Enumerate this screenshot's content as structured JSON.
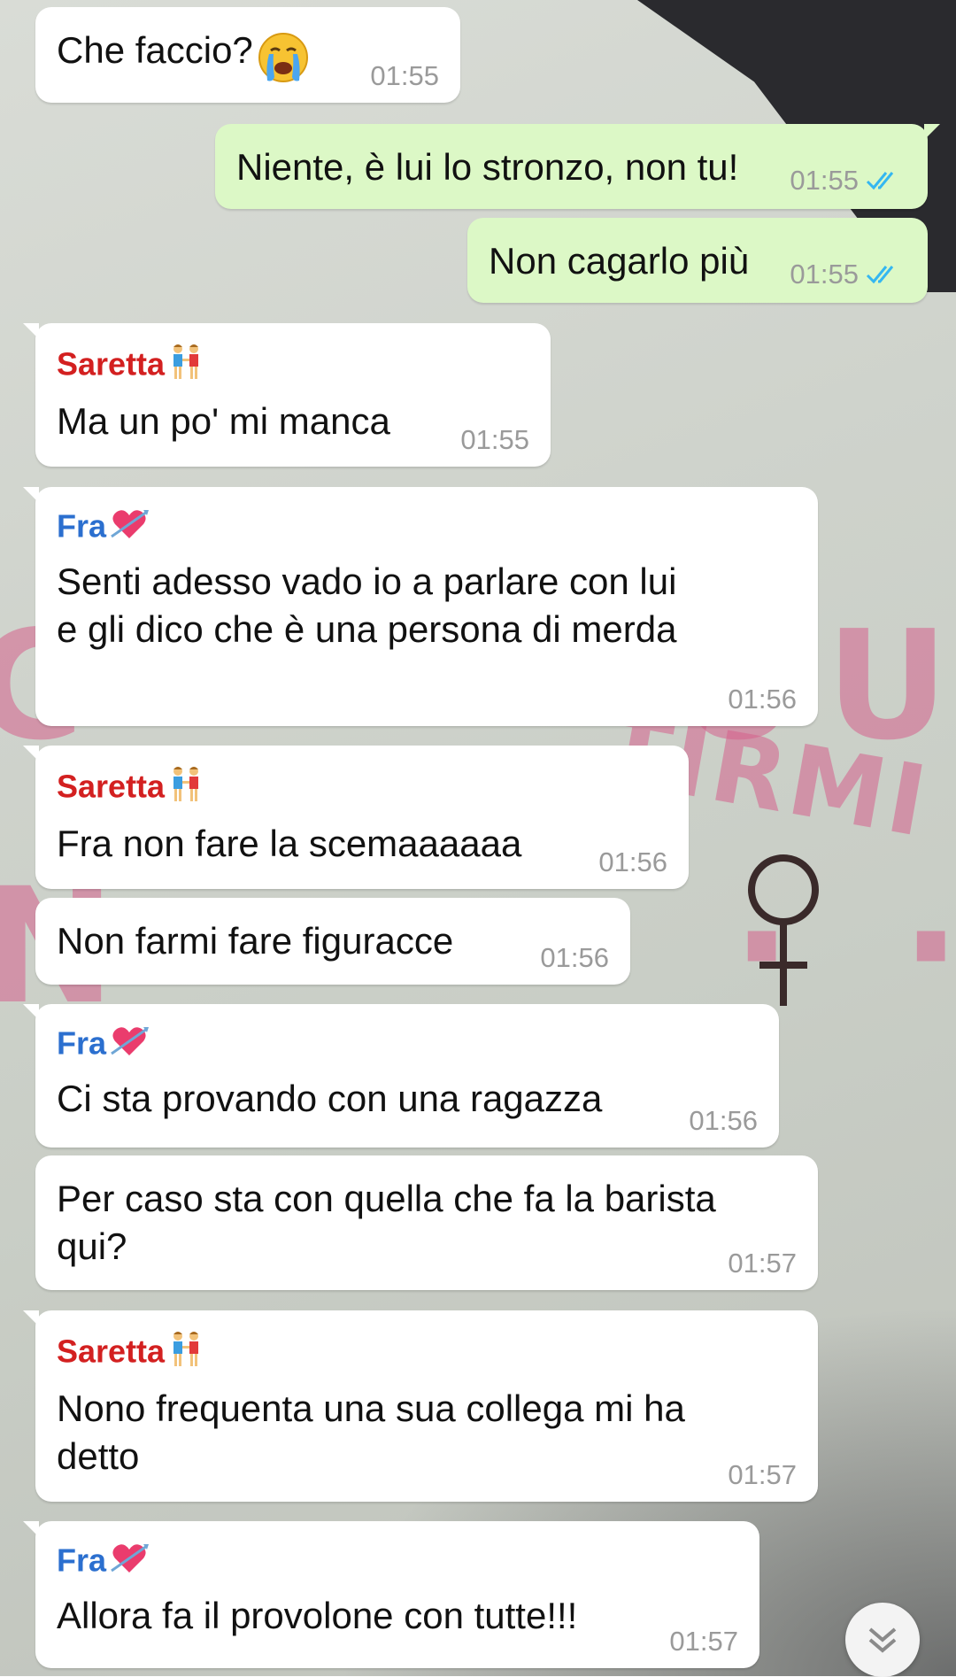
{
  "messages": [
    {
      "sender": "",
      "text": "Che faccio?",
      "emoji": "crying-face",
      "time": "01:55"
    },
    {
      "sender": "",
      "text": "Niente, è lui lo stronzo, non tu!",
      "time": "01:55",
      "status": "read"
    },
    {
      "sender": "",
      "text": "Non cagarlo più",
      "time": "01:55",
      "status": "read"
    },
    {
      "sender": "Saretta",
      "sender_emoji": "two-women-holding-hands",
      "text": "Ma un po' mi manca",
      "time": "01:55"
    },
    {
      "sender": "Fra",
      "sender_emoji": "heart-with-arrow",
      "text": "Senti adesso vado io a parlare con lui\ne gli dico che è una persona di merda",
      "time": "01:56"
    },
    {
      "sender": "Saretta",
      "sender_emoji": "two-women-holding-hands",
      "text": "Fra non fare la scemaaaaaa",
      "time": "01:56"
    },
    {
      "sender": "",
      "text": "Non farmi fare figuracce",
      "time": "01:56"
    },
    {
      "sender": "Fra",
      "sender_emoji": "heart-with-arrow",
      "text": "Ci sta provando con una ragazza",
      "time": "01:56"
    },
    {
      "sender": "",
      "text": "Per caso sta con quella che fa la barista\nqui?",
      "time": "01:57"
    },
    {
      "sender": "Saretta",
      "sender_emoji": "two-women-holding-hands",
      "text": "Nono frequenta una sua collega mi ha\ndetto",
      "time": "01:57"
    },
    {
      "sender": "Fra",
      "sender_emoji": "heart-with-arrow",
      "text": "Allora fa il provolone con tutte!!!",
      "time": "01:57"
    }
  ],
  "scroll_button": {
    "icon": "double-chevron-down-icon"
  },
  "colors": {
    "incoming_bubble": "#ffffff",
    "outgoing_bubble": "#dcf8c6",
    "saretta_name": "#d32020",
    "fra_name": "#2b6fcf",
    "timestamp": "#9a9a9a",
    "read_ticks": "#34b7f1"
  }
}
